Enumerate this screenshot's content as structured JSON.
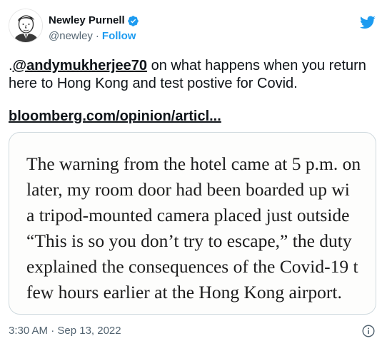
{
  "author": {
    "name": "Newley Purnell",
    "handle": "@newley",
    "separator": "·",
    "follow_label": "Follow"
  },
  "tweet": {
    "lead": ".",
    "mention": "@andymukherjee70",
    "text_after_mention": " on what happens when you return here to Hong Kong and test postive for Covid.",
    "link": "bloomberg.com/opinion/articl..."
  },
  "media": {
    "lines": [
      "The warning from the hotel came at 5 p.m. on",
      "later, my room door had been boarded up wi",
      "a tripod-mounted camera placed just outside",
      "“This is so you don’t try to escape,” the duty",
      "explained the consequences of the Covid-19 t",
      "few hours earlier at the Hong Kong airport."
    ]
  },
  "meta": {
    "timestamp": "3:30 AM · Sep 13, 2022"
  },
  "colors": {
    "accent": "#1d9bf0",
    "text": "#0f1419",
    "secondary": "#536471",
    "border": "#cfd9de"
  },
  "icons": {
    "bird": "twitter-bird-icon",
    "verified": "verified-badge-icon",
    "info": "info-icon"
  }
}
